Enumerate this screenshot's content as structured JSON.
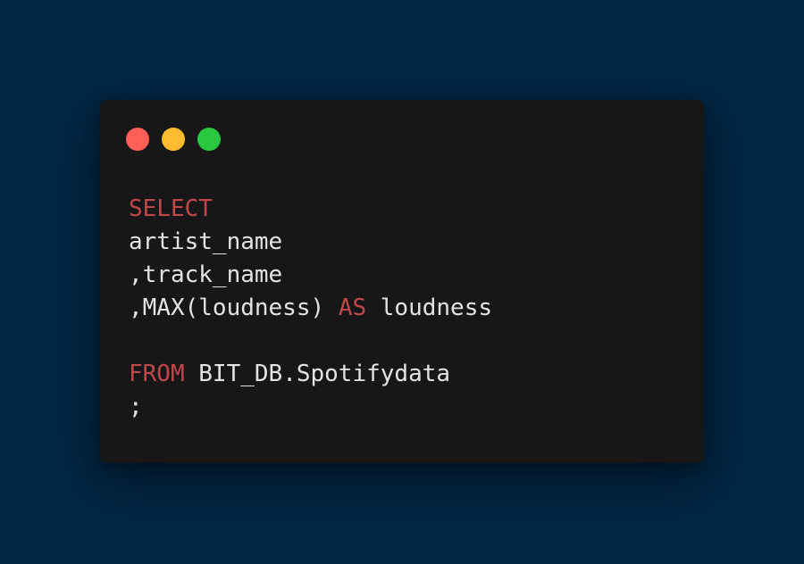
{
  "colors": {
    "background": "#022744",
    "window": "#171717",
    "text": "#e3e3e3",
    "keyword": "#c0484c",
    "close_dot": "#ff5f57",
    "minimize_dot": "#febc2e",
    "maximize_dot": "#28c840"
  },
  "code": {
    "line1": {
      "kw": "SELECT"
    },
    "line2": {
      "text": "artist_name"
    },
    "line3": {
      "text": ",track_name"
    },
    "line4": {
      "pre": ",MAX(loudness) ",
      "kw": "AS",
      "post": " loudness"
    },
    "line5": {
      "text": ""
    },
    "line6": {
      "kw": "FROM",
      "post": " BIT_DB.Spotifydata"
    },
    "line7": {
      "text": ";"
    }
  }
}
